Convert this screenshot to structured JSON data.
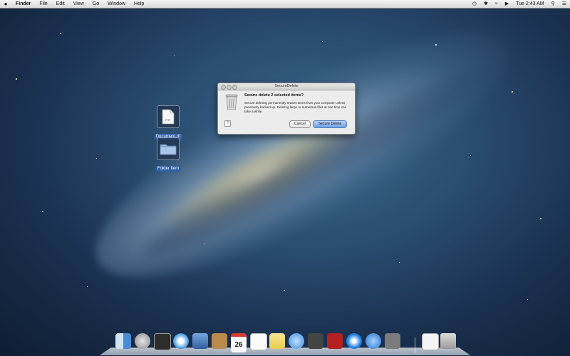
{
  "menubar": {
    "app_name": "Finder",
    "items": [
      "File",
      "Edit",
      "View",
      "Go",
      "Window",
      "Help"
    ],
    "clock": "Tue 2:43 AM"
  },
  "desktop_icons": [
    {
      "label": "Document.rtf",
      "badge": "RTF"
    },
    {
      "label": "Folder Item"
    }
  ],
  "dialog": {
    "title": "SecureDelete",
    "heading": "Secure delete 2 selected items?",
    "message": "Secure deleting permanently erases items from your computer unless previously backed up. Deleting large or numerous files at one time can take a while.",
    "help_label": "?",
    "cancel_label": "Cancel",
    "confirm_label": "Secure Delete"
  },
  "dock": {
    "icons": [
      "finder-icon",
      "launchpad-icon",
      "mission-control-icon",
      "safari-icon",
      "mail-icon",
      "contacts-icon",
      "calendar-icon",
      "reminders-icon",
      "notes-icon",
      "messages-icon",
      "facetime-icon",
      "photo-booth-icon",
      "itunes-icon",
      "app-store-icon",
      "system-preferences-icon",
      "downloads-icon",
      "trash-icon"
    ],
    "calendar_day": "26"
  },
  "colors": {
    "accent": "#6fa1e6",
    "selection_label": "#2f5fa8"
  }
}
